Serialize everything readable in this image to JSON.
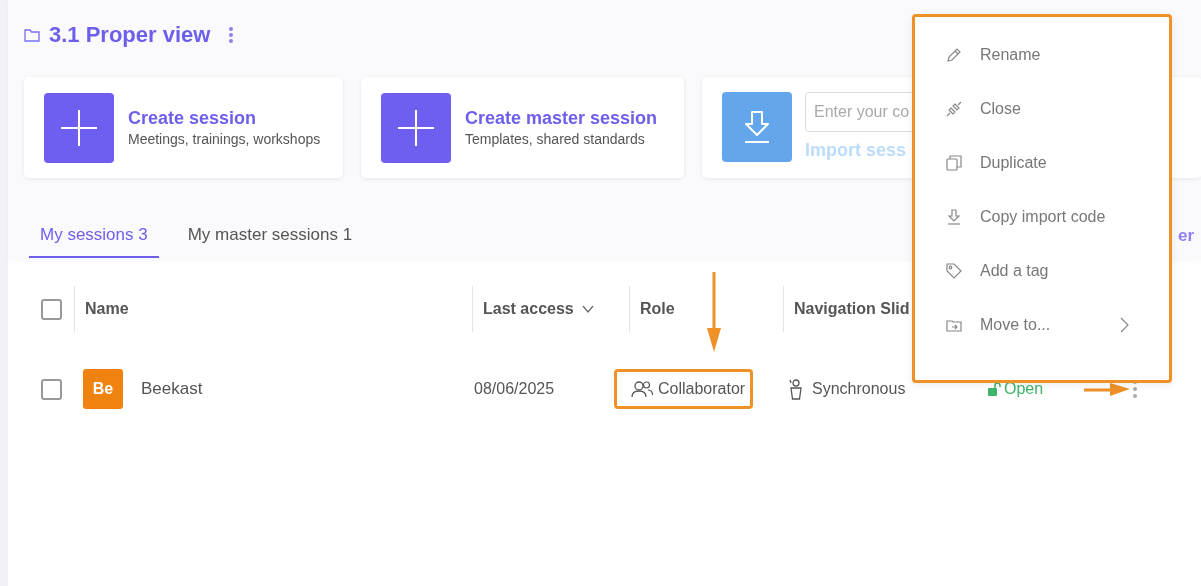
{
  "folder": {
    "title": "3.1 Proper view"
  },
  "actions": [
    {
      "kind": "create",
      "title": "Create session",
      "subtitle": "Meetings, trainings, workshops"
    },
    {
      "kind": "create",
      "title": "Create master session",
      "subtitle": "Templates, shared standards"
    },
    {
      "kind": "import",
      "placeholder": "Enter your co",
      "link": "Import sess"
    }
  ],
  "tabs": [
    {
      "label": "My sessions 3",
      "selected": true
    },
    {
      "label": "My master sessions 1",
      "selected": false
    }
  ],
  "tabs_link": "er",
  "table": {
    "select_all": {
      "checked": false
    },
    "columns": [
      {
        "label": "Name",
        "sortable": false
      },
      {
        "label": "Last access",
        "sortable": true
      },
      {
        "label": "Role",
        "sortable": false
      },
      {
        "label": "Navigation Slid"
      }
    ],
    "rows": [
      {
        "checked": false,
        "avatar": "Be",
        "color": "#f0820f",
        "name": "Beekast",
        "last_access": "08/06/2025",
        "role": "Collaborator",
        "highlighted": true,
        "navigation": "Synchronous",
        "status": "Open",
        "locked": false
      }
    ]
  },
  "menu": {
    "items": [
      {
        "kind": "rename",
        "label": "Rename",
        "submenu": false
      },
      {
        "kind": "close",
        "label": "Close",
        "submenu": false
      },
      {
        "kind": "duplicate",
        "label": "Duplicate",
        "submenu": false
      },
      {
        "kind": "copy",
        "label": "Copy import code",
        "submenu": false
      },
      {
        "kind": "tag",
        "label": "Add a tag",
        "submenu": false
      },
      {
        "kind": "move",
        "label": "Move to...",
        "submenu": true
      }
    ]
  }
}
